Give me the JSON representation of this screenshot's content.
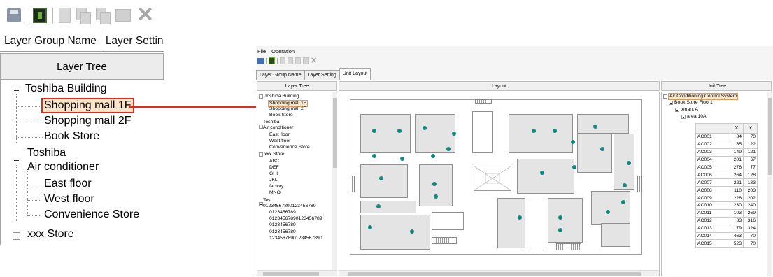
{
  "zoom": {
    "tabs": [
      "Layer Group Name",
      "Layer Settin"
    ],
    "header": "Layer Tree",
    "tree": {
      "building": "Toshiba Building",
      "mall1": "Shopping mall 1F",
      "mall2": "Shopping mall 2F",
      "book": "Book Store",
      "toshiba": "Toshiba",
      "air": "Air conditioner",
      "east": "East floor",
      "west": "West floor",
      "conv": "Convenience Store",
      "xxx": "xxx Store"
    }
  },
  "window": {
    "menu": [
      "File",
      "Operation"
    ],
    "tabs": [
      "Layer Group Name",
      "Layer Setting",
      "Unit Layout"
    ],
    "layer_tree_header": "Layer Tree",
    "layout_header": "Layout",
    "unit_tree_header": "Unit Tree",
    "layer_tree": {
      "building": "Toshiba Building",
      "mall1": "Shopping mall 1F",
      "mall2": "Shopping mall 2F",
      "book": "Book Store",
      "toshiba": "Toshiba",
      "air": "Air conditioner",
      "east": "East floor",
      "west": "West floor",
      "conv": "Convenience Store",
      "xxx": "xxx Store",
      "abc": "ABC",
      "def": "DEF",
      "ghi": "GHI",
      "jkl": "JKL",
      "factory": "factory",
      "mno": "MNO",
      "test": "Test",
      "long1": "01234567890123456789",
      "s1": "0123456789",
      "long2": "01234567890123456789",
      "s2": "0123456789",
      "s3": "0123456789",
      "long3": "12345678901234567890"
    },
    "unit_tree": {
      "root": "Air Conditioning Control System",
      "floor": "Book Store Floor1",
      "tenant": "tenant A",
      "area": "area 10A",
      "col_x": "X",
      "col_y": "Y",
      "rows": [
        {
          "name": "AC001",
          "x": "84",
          "y": "70"
        },
        {
          "name": "AC002",
          "x": "85",
          "y": "122"
        },
        {
          "name": "AC003",
          "x": "149",
          "y": "121"
        },
        {
          "name": "AC004",
          "x": "201",
          "y": "67"
        },
        {
          "name": "AC005",
          "x": "276",
          "y": "77"
        },
        {
          "name": "AC006",
          "x": "264",
          "y": "128"
        },
        {
          "name": "AC007",
          "x": "221",
          "y": "133"
        },
        {
          "name": "AC008",
          "x": "110",
          "y": "203"
        },
        {
          "name": "AC009",
          "x": "226",
          "y": "202"
        },
        {
          "name": "AC010",
          "x": "230",
          "y": "240"
        },
        {
          "name": "AC011",
          "x": "103",
          "y": "269"
        },
        {
          "name": "AC012",
          "x": "83",
          "y": "316"
        },
        {
          "name": "AC013",
          "x": "179",
          "y": "324"
        },
        {
          "name": "AC014",
          "x": "463",
          "y": "70"
        },
        {
          "name": "AC015",
          "x": "523",
          "y": "70"
        }
      ]
    }
  },
  "colors": {
    "selection_fill": "#fbe4c8",
    "arrow": "#e02b20",
    "unit_marker": "#138a7d"
  }
}
